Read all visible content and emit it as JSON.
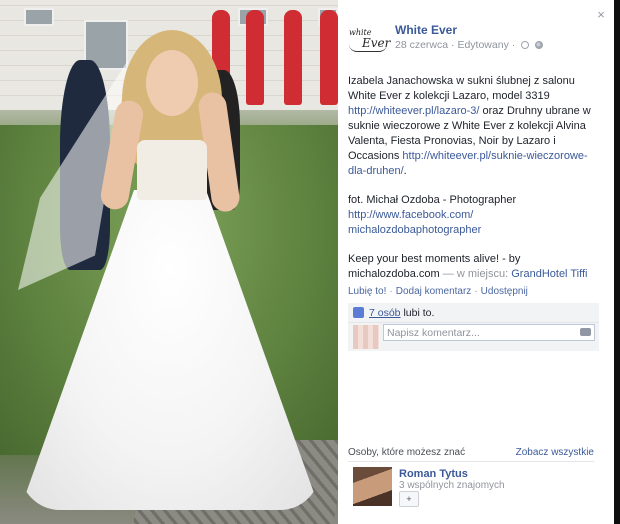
{
  "post": {
    "page_name": "White Ever",
    "date": "28 czerwca",
    "edited": "Edytowany",
    "logo_line1": "white",
    "logo_line2": "Ever",
    "text1": "Izabela Janachowska w sukni ślubnej z salonu White Ever z kolekcji Lazaro, model 3319",
    "link1": "http://whiteever.pl/lazaro-3/",
    "text2": "oraz Druhny ubrane w suknie wieczorowe z White Ever z kolekcji Alvina Valenta, Fiesta Pronovias, Noir by Lazaro i Occasions",
    "link2": "http://whiteever.pl/suknie-wieczorowe-dla-druhen/",
    "text2_end": ".",
    "photo_credit": "fot. Michał Ozdoba - Photographer",
    "link3a": "http://www.facebook.com/",
    "link3b": "michalozdobaphotographer",
    "text4": "Keep your best moments alive! - by",
    "text4_site": "michalozdoba.com",
    "text4_place_prefix": "— w miejscu:",
    "place": "GrandHotel Tiffi"
  },
  "actions": {
    "like": "Lubię to!",
    "comment": "Dodaj komentarz",
    "share": "Udostępnij",
    "separator": "·"
  },
  "likes": {
    "count_link": "7 osób",
    "suffix": "lubi to."
  },
  "comment": {
    "placeholder": "Napisz komentarz..."
  },
  "people": {
    "heading": "Osoby, które możesz znać",
    "see_all": "Zobacz wszystkie",
    "person_name": "Roman Tytus",
    "mutual": "3 wspólnych znajomych",
    "add_icon": "+"
  },
  "close_icon": "×",
  "colors": {
    "link": "#3b5998",
    "muted": "#90949c",
    "text": "#1d2129"
  }
}
